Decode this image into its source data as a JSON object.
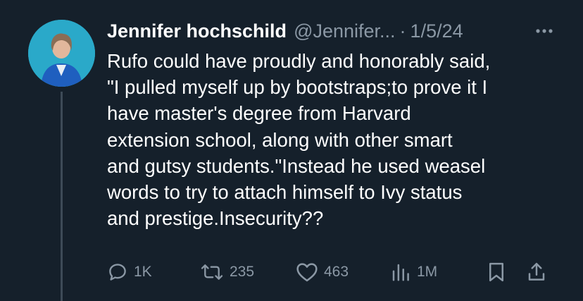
{
  "tweet": {
    "author_name": "Jennifer hochschild",
    "handle": "@Jennifer...",
    "separator": "·",
    "date": "1/5/24",
    "text": "Rufo could have proudly and honorably said,\n\"I pulled myself up by bootstraps;to prove it I\nhave master's degree from Harvard\nextension school, along with other smart\nand gutsy students.\"Instead he used weasel\nwords to try to attach himself to Ivy status\nand prestige.Insecurity??"
  },
  "actions": {
    "replies": "1K",
    "reposts": "235",
    "likes": "463",
    "views": "1M"
  },
  "icons": {
    "more": "more-horizontal-icon",
    "reply": "reply-icon",
    "repost": "repost-icon",
    "like": "heart-icon",
    "views": "views-bar-chart-icon",
    "bookmark": "bookmark-icon",
    "share": "share-icon"
  },
  "colors": {
    "background": "#15202b",
    "text": "#ffffff",
    "muted": "#8b98a5",
    "thread_line": "#3d4a57",
    "avatar_bg": "#2aa9c9"
  }
}
